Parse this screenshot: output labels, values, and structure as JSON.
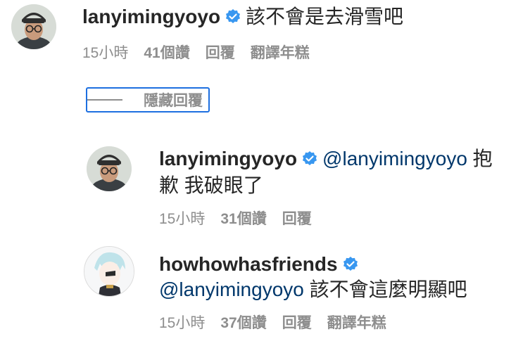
{
  "comments": [
    {
      "username": "lanyimingyoyo",
      "mention": "",
      "text": "該不會是去滑雪吧",
      "text_line2": "",
      "time": "15小時",
      "likes": "41個讚",
      "reply": "回覆",
      "translate": "翻譯年糕"
    },
    {
      "username": "lanyimingyoyo",
      "mention": "@lanyimingyoyo",
      "text": "抱",
      "text_line2": "歉 我破眼了",
      "time": "15小時",
      "likes": "31個讚",
      "reply": "回覆",
      "translate": ""
    },
    {
      "username": "howhowhasfriends",
      "mention": "@lanyimingyoyo",
      "text": "該不會這麼明顯吧",
      "text_line2": "",
      "time": "15小時",
      "likes": "37個讚",
      "reply": "回覆",
      "translate": "翻譯年糕"
    }
  ],
  "hide_replies": {
    "label": "隱藏回覆"
  },
  "icons": {
    "verified": "verified-badge-icon",
    "avatar1": "avatar",
    "avatar2": "avatar",
    "avatar3": "avatar"
  },
  "colors": {
    "verified": "#3897f0",
    "mention": "#00376b",
    "meta": "#8e8e8e",
    "focus": "#1d6fe0"
  }
}
